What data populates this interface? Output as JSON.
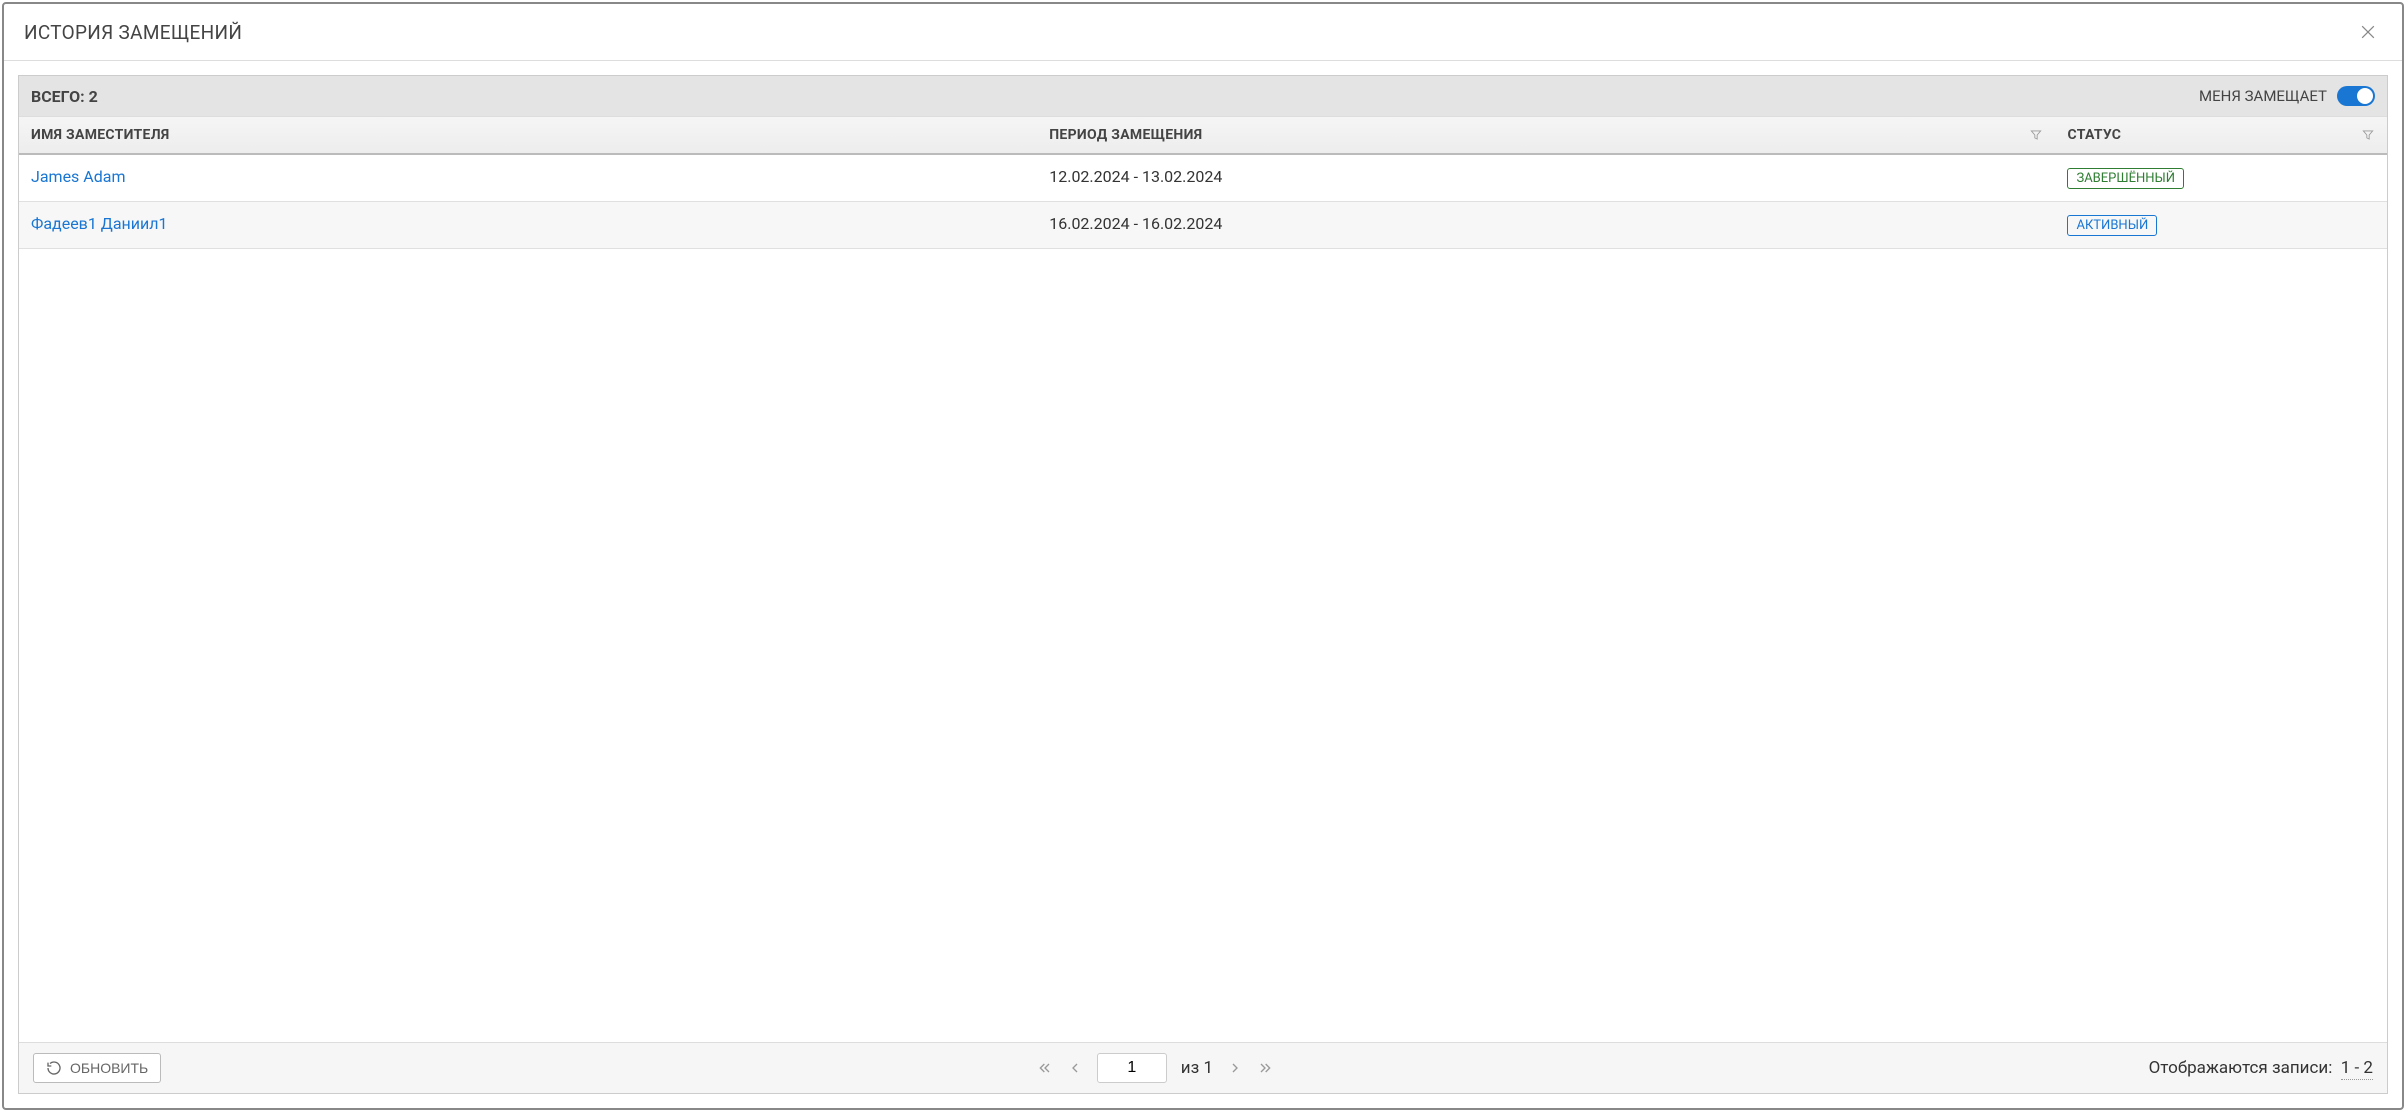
{
  "dialog": {
    "title": "ИСТОРИЯ ЗАМЕЩЕНИЙ"
  },
  "toolbar": {
    "total_label": "ВСЕГО: 2",
    "toggle_label": "МЕНЯ ЗАМЕЩАЕТ"
  },
  "columns": {
    "name": "ИМЯ ЗАМЕСТИТЕЛЯ",
    "period": "ПЕРИОД ЗАМЕЩЕНИЯ",
    "status": "СТАТУС"
  },
  "rows": [
    {
      "name": "James Adam",
      "period": "12.02.2024 - 13.02.2024",
      "status": "ЗАВЕРШЁННЫЙ",
      "status_kind": "completed"
    },
    {
      "name": "Фадеев1 Даниил1",
      "period": "16.02.2024 - 16.02.2024",
      "status": "АКТИВНЫЙ",
      "status_kind": "active"
    }
  ],
  "footer": {
    "refresh_label": "ОБНОВИТЬ",
    "page_value": "1",
    "page_of": "из 1",
    "records_label": "Отображаются записи:",
    "records_range": "1 - 2"
  }
}
